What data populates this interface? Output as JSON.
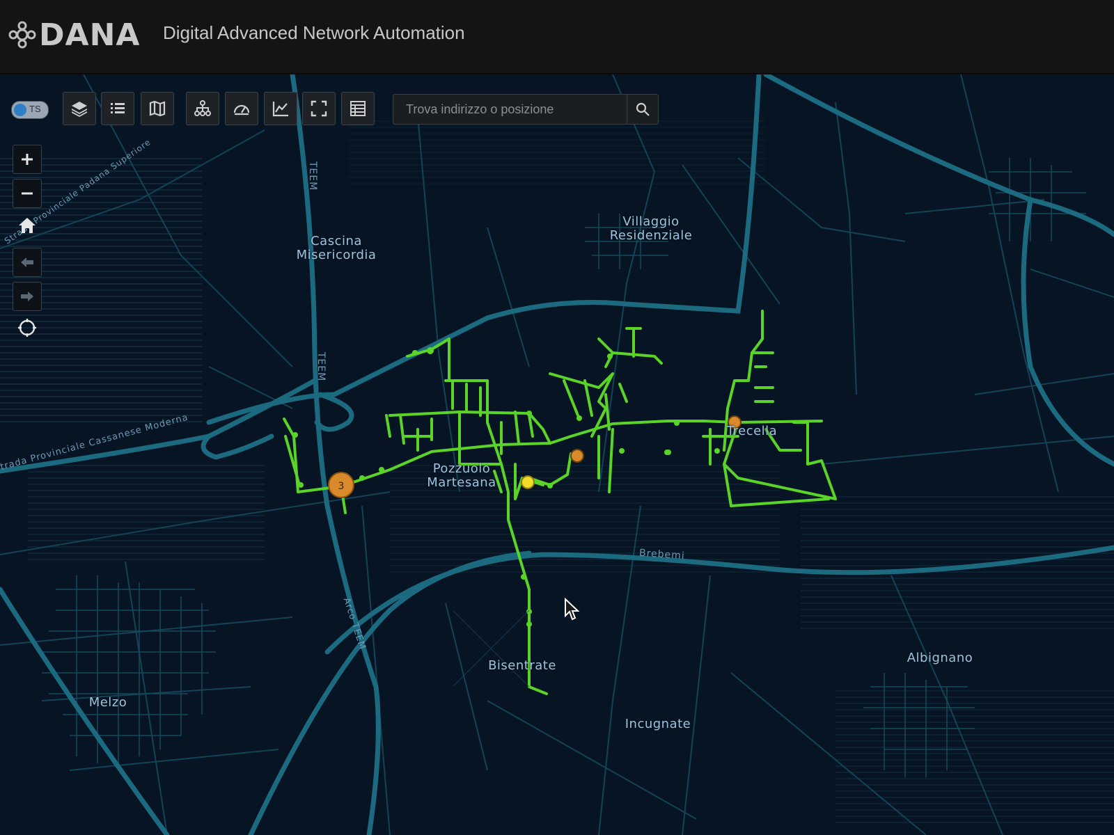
{
  "header": {
    "logo_text": "DANA",
    "app_title": "Digital Advanced Network Automation"
  },
  "toolbar": {
    "toggle_label": "TS",
    "buttons": [
      "layers-icon",
      "list-icon",
      "map-icon",
      "network-icon",
      "gauge-icon",
      "chart-icon",
      "fullscreen-icon",
      "table-icon"
    ]
  },
  "search": {
    "placeholder": "Trova indirizzo o posizione"
  },
  "map_labels": {
    "cascina": "Cascina\nMisericordia",
    "villaggio": "Villaggio\nResidenziale",
    "pozzuolo": "Pozzuolo\nMartesana",
    "trecella": "Trecella",
    "bisentrate": "Bisentrate",
    "melzo": "Melzo",
    "albignano": "Albignano",
    "incugnate": "Incugnate",
    "brebemi": "Brebemi",
    "teem_north": "TEEM",
    "teem_mid": "TEEM",
    "arco_teem": "Arco TEEM",
    "sp_cassanese": "Strada Provinciale Cassanese Moderna",
    "sp_north": "Strada Provinciale Padana Superiore"
  },
  "cluster_marker": {
    "count": "3"
  },
  "colors": {
    "network": "#5ad428",
    "road": "#1c6a80",
    "marker_orange": "#d98a2a",
    "marker_yellow": "#f2dc2a"
  }
}
